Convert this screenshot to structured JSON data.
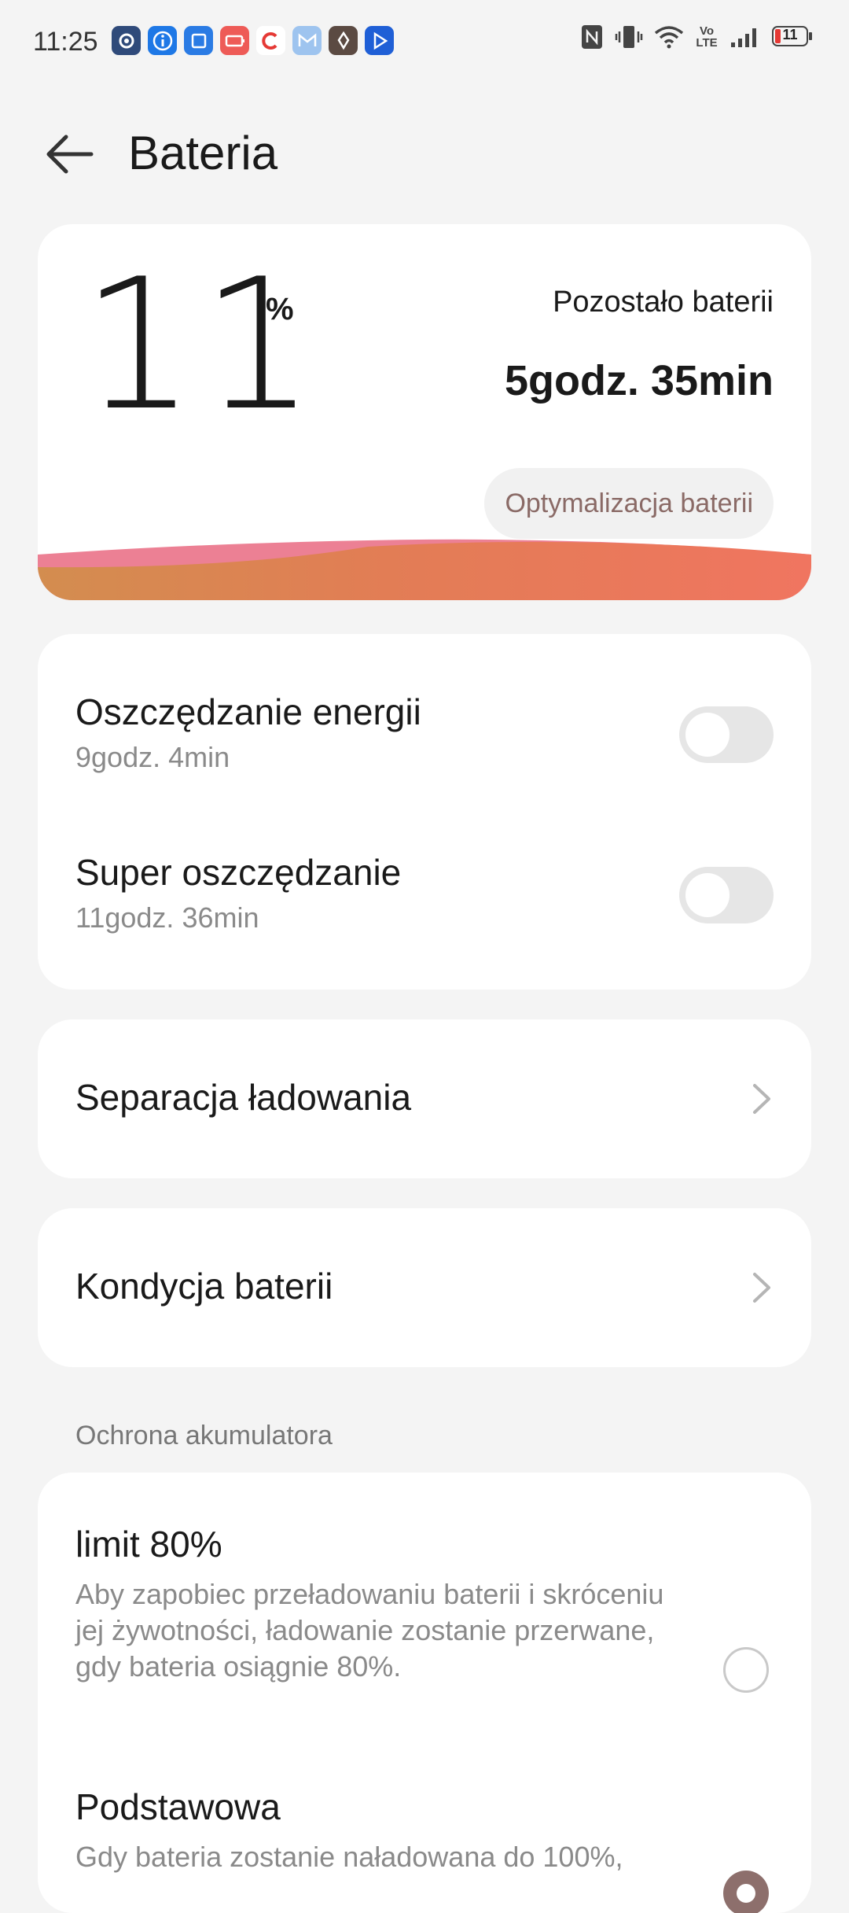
{
  "status_bar": {
    "time": "11:25",
    "notification_icons": [
      "settings-icon",
      "info-icon",
      "copy-icon",
      "battery-saver-icon",
      "app-c-icon",
      "mail-icon",
      "leaf-icon",
      "play-icon"
    ],
    "battery_level": "11",
    "volte": "Vo LTE"
  },
  "header": {
    "title": "Bateria"
  },
  "battery": {
    "percent": "11",
    "percent_sign": "%",
    "remaining_label": "Pozostało baterii",
    "remaining_value": "5godz. 35min",
    "optimize_button": "Optymalizacja baterii",
    "colors": {
      "wave_start": "#d38d4f",
      "wave_end": "#f07560",
      "wave_pink": "#ec8094"
    }
  },
  "power_saving": {
    "label": "Oszczędzanie energii",
    "subtitle": "9godz. 4min",
    "enabled": false
  },
  "super_saving": {
    "label": "Super oszczędzanie",
    "subtitle": "11godz. 36min",
    "enabled": false
  },
  "charge_separation": {
    "label": "Separacja ładowania"
  },
  "battery_health": {
    "label": "Kondycja baterii"
  },
  "protection": {
    "section_label": "Ochrona akumulatora",
    "options": [
      {
        "title": "limit 80%",
        "description": "Aby zapobiec przeładowaniu baterii i skróceniu jej żywotności, ładowanie zostanie przerwane, gdy bateria osiągnie 80%.",
        "selected": false
      },
      {
        "title": "Podstawowa",
        "description": "Gdy bateria zostanie naładowana do 100%,",
        "selected": true
      }
    ]
  },
  "colors": {
    "background": "#f4f4f4",
    "card": "#ffffff",
    "accent": "#8d6f6c"
  }
}
